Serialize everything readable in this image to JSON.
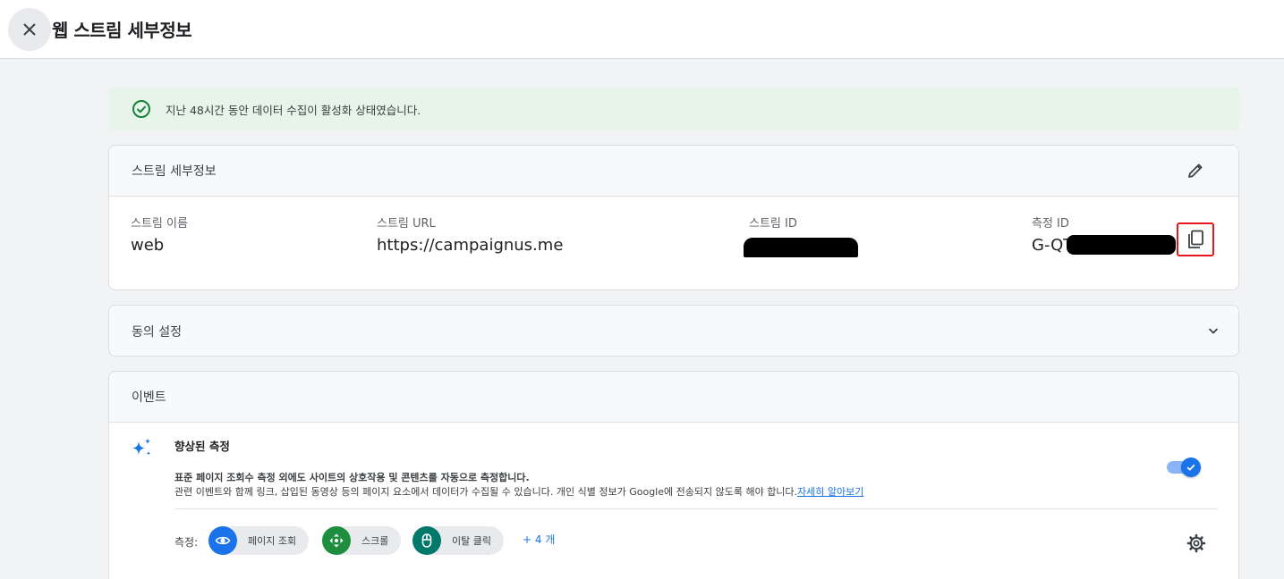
{
  "header": {
    "title": "웹 스트림 세부정보",
    "close_icon": "close-icon"
  },
  "banner": {
    "text": "지난 48시간 동안 데이터 수집이 활성화 상태였습니다.",
    "icon": "check-circle-icon",
    "color": "#188038"
  },
  "stream_details": {
    "title": "스트림 세부정보",
    "edit_icon": "pencil-icon",
    "fields": {
      "name_label": "스트림 이름",
      "name_value": "web",
      "url_label": "스트림 URL",
      "url_value": "https://campaignus.me",
      "id_label": "스트림 ID",
      "measurement_label": "측정 ID",
      "measurement_value_prefix": "G-QT"
    },
    "copy_icon": "copy-icon"
  },
  "consent": {
    "title": "동의 설정",
    "chevron_icon": "chevron-down-icon"
  },
  "events": {
    "title": "이벤트",
    "enhanced": {
      "icon": "sparkle-icon",
      "title": "향상된 측정",
      "desc_line1": "표준 페이지 조회수 측정 외에도 사이트의 상호작용 및 콘텐츠를 자동으로 측정합니다.",
      "desc_line2": "관련 이벤트와 함께 링크, 삽입된 동영상 등의 페이지 요소에서 데이터가 수집될 수 있습니다. 개인 식별 정보가 Google에 전송되지 않도록 해야 합니다.",
      "learn_more": "자세히 알아보기",
      "toggle_on": true,
      "measure_label": "측정:",
      "chips": [
        {
          "label": "페이지 조회",
          "icon": "eye-icon",
          "color": "#1a73e8"
        },
        {
          "label": "스크롤",
          "icon": "scroll-arrows-icon",
          "color": "#1e8e3e"
        },
        {
          "label": "이탈 클릭",
          "icon": "mouse-icon",
          "color": "#00796b"
        }
      ],
      "more_label": "+ 4 개",
      "settings_icon": "gear-icon"
    }
  }
}
